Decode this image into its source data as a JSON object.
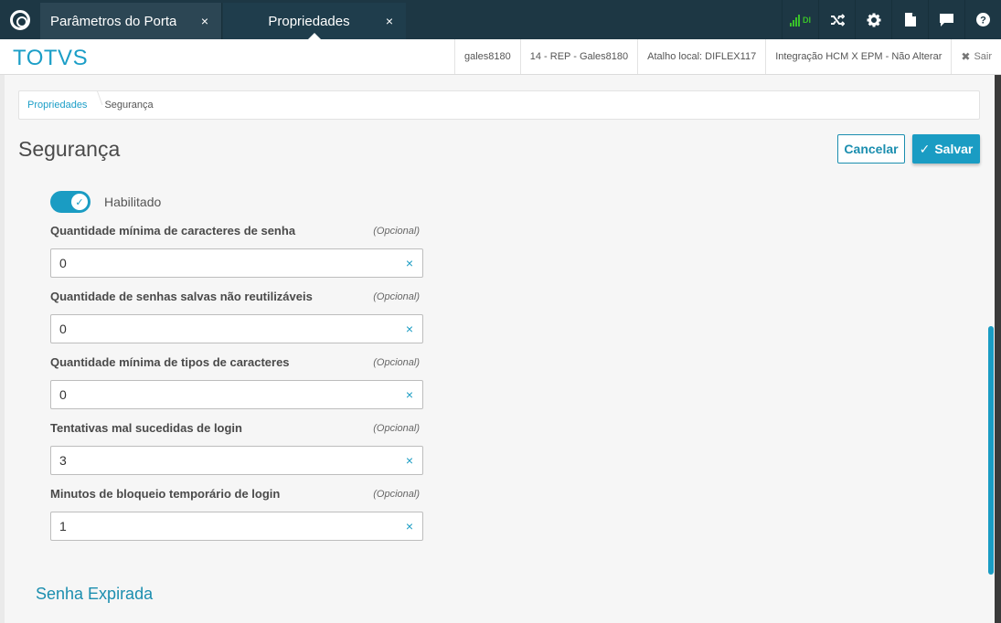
{
  "tabs": [
    {
      "label": "Parâmetros do Portal c",
      "close": "×"
    },
    {
      "label": "Propriedades",
      "close": "×"
    }
  ],
  "toolbar": {
    "signal_text": "DI",
    "icons": [
      "signal-icon",
      "shuffle-icon",
      "gear-icon",
      "document-icon",
      "chat-icon",
      "help-icon"
    ],
    "accent_color": "#39c12a"
  },
  "header": {
    "brand": "TOTVS",
    "user": "gales8180",
    "company": "14 - REP - Gales8180",
    "shortcut": "Atalho local: DIFLEX117",
    "integration": "Integração HCM X EPM - Não Alterar",
    "exit_icon": "✖",
    "exit_label": "Sair"
  },
  "breadcrumb": {
    "parent": "Propriedades",
    "current": "Segurança"
  },
  "page": {
    "title": "Segurança",
    "cancel_label": "Cancelar",
    "save_icon": "✓",
    "save_label": "Salvar"
  },
  "toggle": {
    "label": "Habilitado",
    "checked": true,
    "check_icon": "✓"
  },
  "fields": [
    {
      "label": "Quantidade mínima de caracteres de senha",
      "optional": "(Opcional)",
      "value": "0",
      "clear": "×"
    },
    {
      "label": "Quantidade de senhas salvas não reutilizáveis",
      "optional": "(Opcional)",
      "value": "0",
      "clear": "×"
    },
    {
      "label": "Quantidade mínima de tipos de caracteres",
      "optional": "(Opcional)",
      "value": "0",
      "clear": "×"
    },
    {
      "label": "Tentativas mal sucedidas de login",
      "optional": "(Opcional)",
      "value": "3",
      "clear": "×"
    },
    {
      "label": "Minutos de bloqueio temporário de login",
      "optional": "(Opcional)",
      "value": "1",
      "clear": "×"
    }
  ],
  "next_section": "Senha Expirada",
  "colors": {
    "brand": "#1b9ec7",
    "primary": "#1a9cc3",
    "topbar": "#1d3744"
  }
}
